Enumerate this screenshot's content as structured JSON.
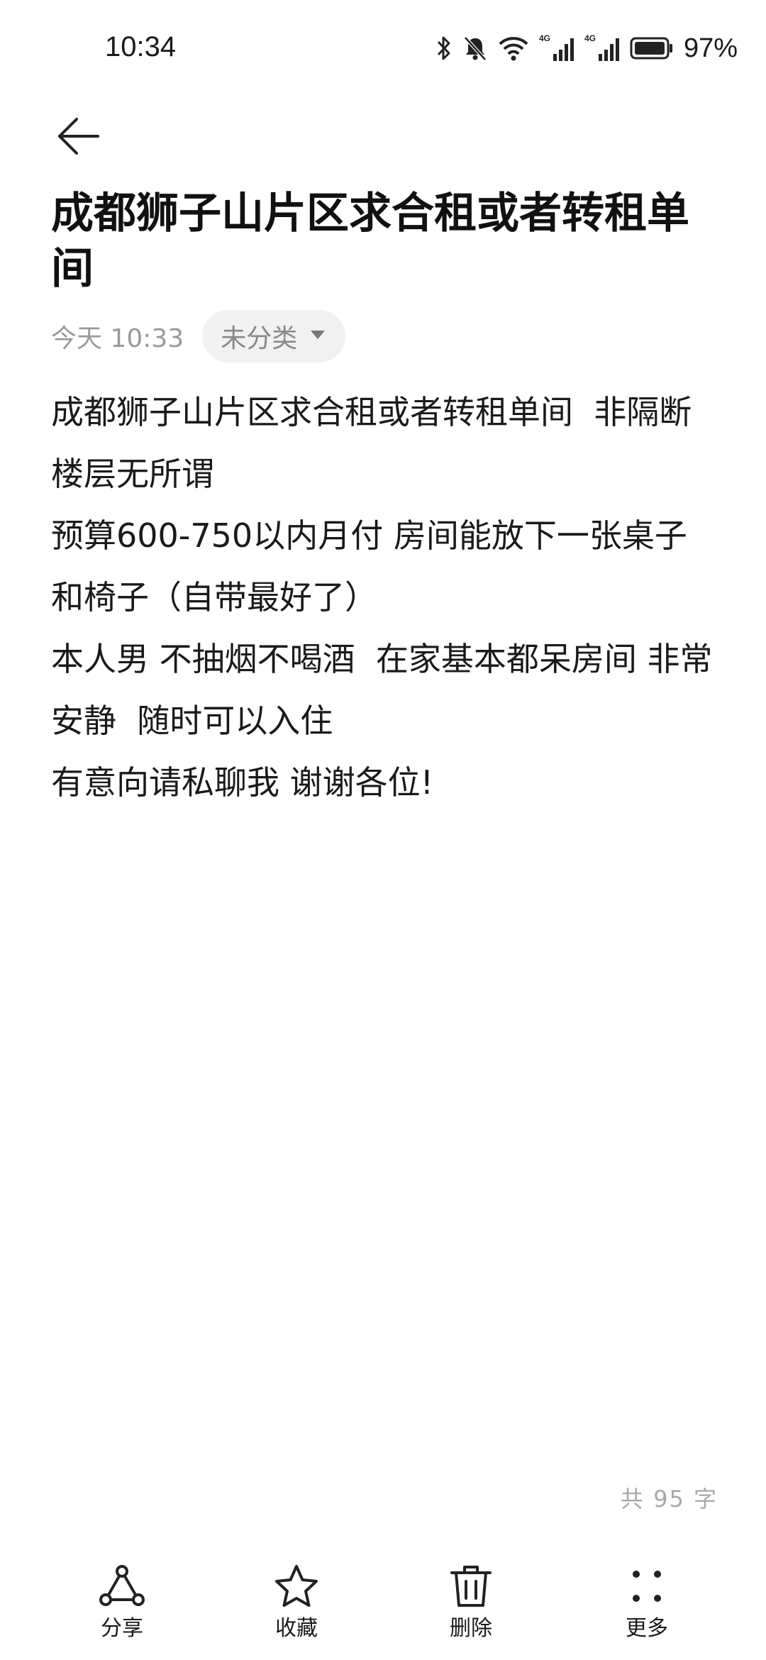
{
  "status_bar": {
    "time": "10:34",
    "battery_percent": "97%",
    "network_1": "4G",
    "network_2": "4G",
    "icons": [
      "bluetooth-icon",
      "mute-bell-icon",
      "wifi-icon",
      "signal-icon",
      "signal-icon",
      "battery-icon"
    ]
  },
  "header": {
    "back_icon": "arrow-left-icon"
  },
  "note": {
    "title": "成都狮子山片区求合租或者转租单间",
    "timestamp": "今天 10:33",
    "category": "未分类",
    "body_lines": [
      "成都狮子山片区求合租或者转租单间  非隔断 楼层无所谓",
      "预算600-750以内月付 房间能放下一张桌子和椅子（自带最好了）",
      "本人男 不抽烟不喝酒  在家基本都呆房间 非常安静  随时可以入住",
      "有意向请私聊我 谢谢各位!"
    ],
    "word_count": "共 95 字"
  },
  "toolbar": {
    "share_label": "分享",
    "favorite_label": "收藏",
    "delete_label": "删除",
    "more_label": "更多"
  }
}
